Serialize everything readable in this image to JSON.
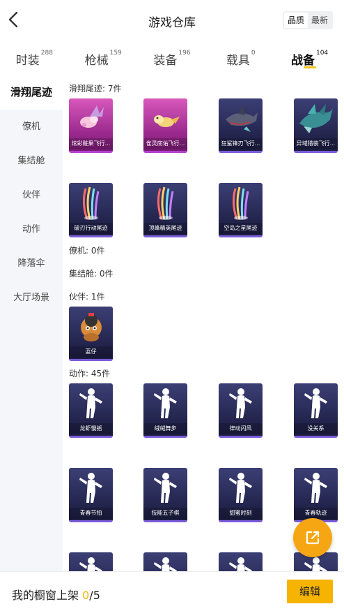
{
  "header": {
    "title": "游戏仓库",
    "back_icon": "chevron-left-icon",
    "sort_options": [
      "品质",
      "最新"
    ],
    "sort_selected": "品质"
  },
  "tabs": [
    {
      "label": "时装",
      "count": "288"
    },
    {
      "label": "枪械",
      "count": "159"
    },
    {
      "label": "装备",
      "count": "196"
    },
    {
      "label": "载具",
      "count": "0"
    },
    {
      "label": "战备",
      "count": "104"
    }
  ],
  "active_tab": "战备",
  "sidebar": {
    "items": [
      {
        "label": "滑翔尾迹"
      },
      {
        "label": "僚机"
      },
      {
        "label": "集结舱"
      },
      {
        "label": "伙伴"
      },
      {
        "label": "动作"
      },
      {
        "label": "降落伞"
      },
      {
        "label": "大厅场景"
      }
    ],
    "active": "滑翔尾迹"
  },
  "sections": [
    {
      "title": "滑翔尾迹: 7件",
      "items": [
        {
          "label": "炫彩赃果飞行...",
          "style": "pink",
          "art": "fruit"
        },
        {
          "label": "雀灵庇佑飞行...",
          "style": "pink",
          "art": "bird"
        },
        {
          "label": "狂鲨锋刃飞行...",
          "style": "purple",
          "art": "shark"
        },
        {
          "label": "异域猎装飞行...",
          "style": "purple",
          "art": "dragon"
        },
        {
          "label": "破刃行动尾迹",
          "style": "purple",
          "art": "trail"
        },
        {
          "label": "顶峰精英尾迹",
          "style": "purple",
          "art": "trail"
        },
        {
          "label": "空岛之星尾迹",
          "style": "purple",
          "art": "trail"
        }
      ]
    },
    {
      "title": "僚机: 0件",
      "items": []
    },
    {
      "title": "集结舱: 0件",
      "items": []
    },
    {
      "title": "伙伴: 1件",
      "items": [
        {
          "label": "蓝仔",
          "style": "purple",
          "art": "buddy"
        }
      ]
    },
    {
      "title": "动作: 45件",
      "items": [
        {
          "label": "龙虾慢摇",
          "style": "purple",
          "art": "pose"
        },
        {
          "label": "绒绒舞步",
          "style": "purple",
          "art": "pose"
        },
        {
          "label": "律动闪风",
          "style": "purple",
          "art": "pose"
        },
        {
          "label": "没关系",
          "style": "purple",
          "art": "pose"
        },
        {
          "label": "青春节拍",
          "style": "purple",
          "art": "pose"
        },
        {
          "label": "技能五子棋",
          "style": "purple",
          "art": "pose"
        },
        {
          "label": "甜蜜时刻",
          "style": "purple",
          "art": "pose"
        },
        {
          "label": "青春轨迹",
          "style": "purple",
          "art": "pose"
        },
        {
          "label": "",
          "style": "purple",
          "art": "pose"
        },
        {
          "label": "",
          "style": "purple",
          "art": "pose"
        },
        {
          "label": "",
          "style": "purple",
          "art": "pose"
        },
        {
          "label": "",
          "style": "purple",
          "art": "pose"
        }
      ]
    }
  ],
  "fab": {
    "icon": "share-external-icon"
  },
  "bottom": {
    "shelf_label": "我的橱窗上架",
    "shelf_current": "0",
    "shelf_total": "/5",
    "edit_label": "编辑"
  },
  "colors": {
    "accent": "#f6b400",
    "fab": "#f6a612",
    "card_purple": "#2a2c5a",
    "card_pink": "#b23aa0"
  }
}
